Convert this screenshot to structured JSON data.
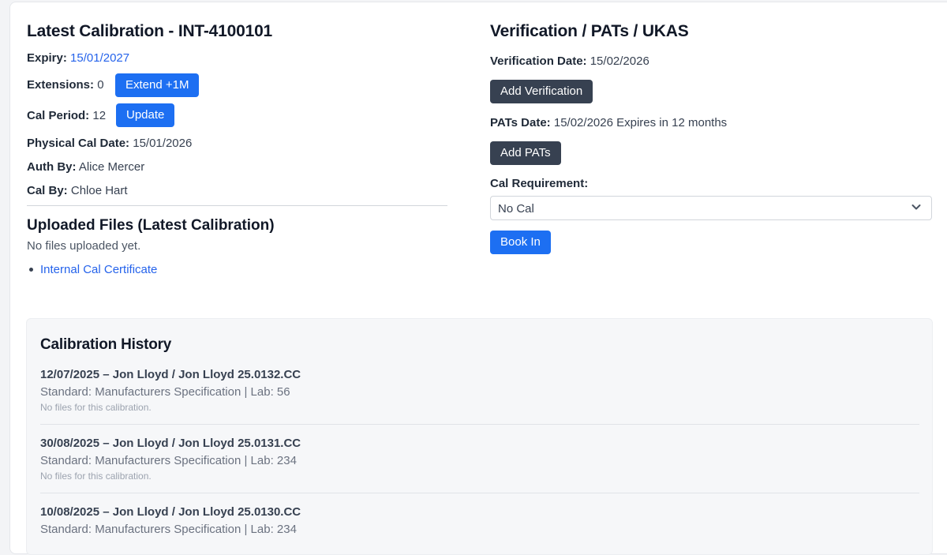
{
  "latest": {
    "title": "Latest Calibration - INT-4100101",
    "expiry_label": "Expiry:",
    "expiry_value": "15/01/2027",
    "extensions_label": "Extensions:",
    "extensions_value": "0",
    "extend_button": "Extend +1M",
    "cal_period_label": "Cal Period:",
    "cal_period_value": "12",
    "update_button": "Update",
    "physical_label": "Physical Cal Date:",
    "physical_value": "15/01/2026",
    "auth_label": "Auth By:",
    "auth_value": "Alice Mercer",
    "cal_by_label": "Cal By:",
    "cal_by_value": "Chloe Hart"
  },
  "uploaded": {
    "title": "Uploaded Files (Latest Calibration)",
    "empty_text": "No files uploaded yet.",
    "files": [
      "Internal Cal Certificate"
    ]
  },
  "verification": {
    "title": "Verification / PATs / UKAS",
    "verification_label": "Verification Date:",
    "verification_value": "15/02/2026",
    "add_verification_button": "Add Verification",
    "pats_label": "PATs Date:",
    "pats_value": "15/02/2026 Expires in 12 months",
    "add_pats_button": "Add PATs",
    "cal_requirement_label": "Cal Requirement:",
    "cal_requirement_value": "No Cal",
    "book_in_button": "Book In"
  },
  "history": {
    "title": "Calibration History",
    "entries": [
      {
        "title": "12/07/2025 – Jon Lloyd / Jon Lloyd 25.0132.CC",
        "subtitle": "Standard: Manufacturers Specification | Lab: 56",
        "note": "No files for this calibration."
      },
      {
        "title": "30/08/2025 – Jon Lloyd / Jon Lloyd 25.0131.CC",
        "subtitle": "Standard: Manufacturers Specification | Lab: 234",
        "note": "No files for this calibration."
      },
      {
        "title": "10/08/2025 – Jon Lloyd / Jon Lloyd 25.0130.CC",
        "subtitle": "Standard: Manufacturers Specification | Lab: 234",
        "note": ""
      }
    ]
  },
  "colors": {
    "primary": "#1d6ff2",
    "dark_button": "#374151",
    "link": "#2563eb"
  },
  "icons": {
    "select_chevron": "chevron-down-icon"
  }
}
